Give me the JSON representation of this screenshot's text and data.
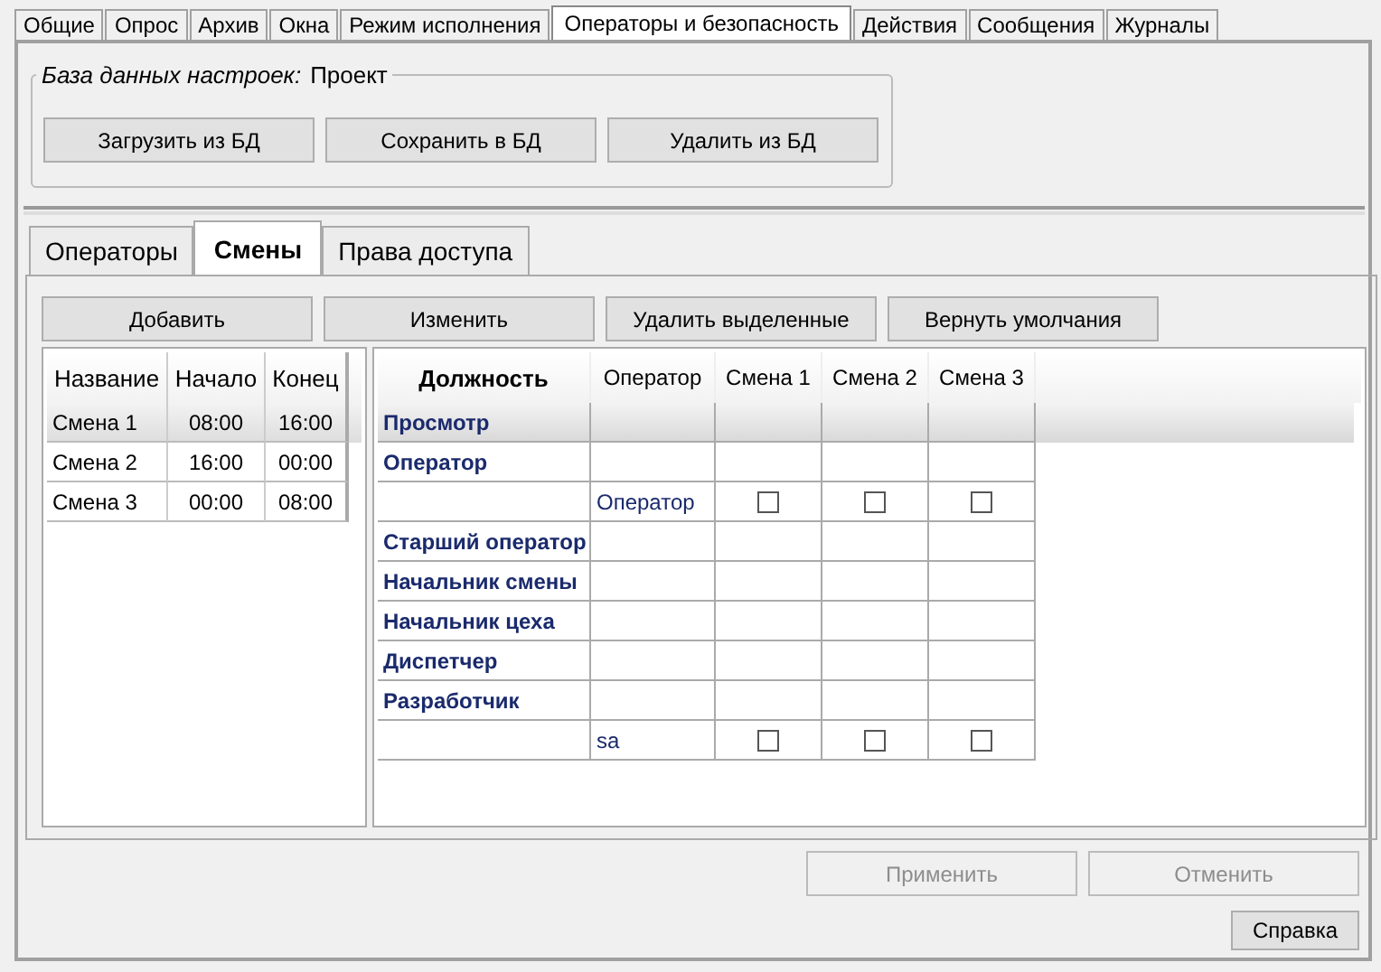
{
  "tabs": [
    {
      "label": "Общие",
      "selected": false
    },
    {
      "label": "Опрос",
      "selected": false
    },
    {
      "label": "Архив",
      "selected": false
    },
    {
      "label": "Окна",
      "selected": false
    },
    {
      "label": "Режим исполнения",
      "selected": false
    },
    {
      "label": "Операторы и безопасность",
      "selected": true
    },
    {
      "label": "Действия",
      "selected": false
    },
    {
      "label": "Сообщения",
      "selected": false
    },
    {
      "label": "Журналы",
      "selected": false
    }
  ],
  "settings_db": {
    "caption": "База данных настроек:",
    "value": "Проект",
    "buttons": [
      "Загрузить из БД",
      "Сохранить в БД",
      "Удалить из БД"
    ]
  },
  "subtabs": [
    {
      "label": "Операторы",
      "selected": false
    },
    {
      "label": "Смены",
      "selected": true
    },
    {
      "label": "Права доступа",
      "selected": false
    }
  ],
  "toolbar": [
    "Добавить",
    "Изменить",
    "Удалить выделенные",
    "Вернуть умолчания"
  ],
  "shifts": {
    "columns": [
      "Название",
      "Начало",
      "Конец"
    ],
    "rows": [
      {
        "cells": [
          "Смена 1",
          "08:00",
          "16:00"
        ],
        "selected": true
      },
      {
        "cells": [
          "Смена 2",
          "16:00",
          "00:00"
        ],
        "selected": false
      },
      {
        "cells": [
          "Смена 3",
          "00:00",
          "08:00"
        ],
        "selected": false
      }
    ]
  },
  "roles": {
    "columns": [
      "Должность",
      "Оператор",
      "Смена 1",
      "Смена 2",
      "Смена 3"
    ],
    "rows": [
      {
        "kind": "role",
        "label": "Просмотр",
        "selected": true
      },
      {
        "kind": "role",
        "label": "Оператор",
        "selected": false
      },
      {
        "kind": "operator",
        "operator": "Оператор",
        "shifts": [
          false,
          false,
          false
        ],
        "selected": false
      },
      {
        "kind": "role",
        "label": "Старший оператор",
        "selected": false
      },
      {
        "kind": "role",
        "label": "Начальник смены",
        "selected": false
      },
      {
        "kind": "role",
        "label": "Начальник цеха",
        "selected": false
      },
      {
        "kind": "role",
        "label": "Диспетчер",
        "selected": false
      },
      {
        "kind": "role",
        "label": "Разработчик",
        "selected": false
      },
      {
        "kind": "operator",
        "operator": "sa",
        "shifts": [
          false,
          false,
          false
        ],
        "selected": false
      }
    ]
  },
  "footer": [
    {
      "label": "Применить",
      "disabled": true
    },
    {
      "label": "Отменить",
      "disabled": true
    }
  ],
  "help_button": "Справка"
}
